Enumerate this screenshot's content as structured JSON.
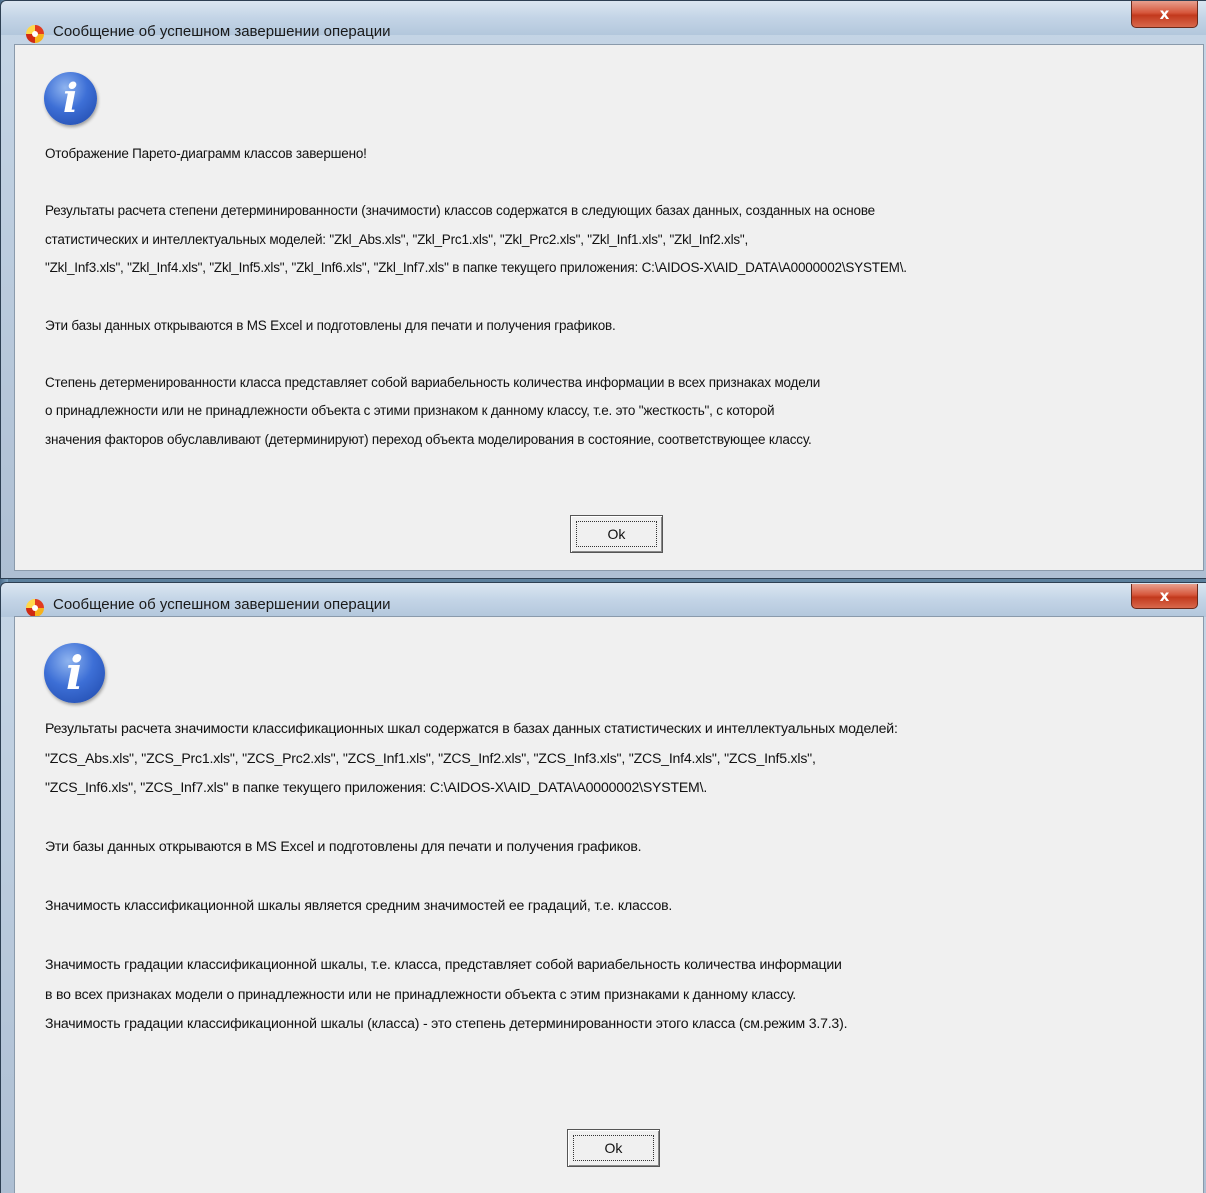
{
  "dialog1": {
    "title": "Сообщение об успешном завершении операции",
    "close_label": "x",
    "paragraphs": [
      [
        "Отображение Парето-диаграмм классов завершено!"
      ],
      [
        "Результаты расчета степени детерминированности (значимости) классов содержатся в следующих базах данных, созданных на основе",
        "статистических и интеллектуальных моделей: \"Zkl_Abs.xls\", \"Zkl_Prc1.xls\", \"Zkl_Prc2.xls\", \"Zkl_Inf1.xls\", \"Zkl_Inf2.xls\",",
        "\"Zkl_Inf3.xls\", \"Zkl_Inf4.xls\", \"Zkl_Inf5.xls\", \"Zkl_Inf6.xls\", \"Zkl_Inf7.xls\" в папке текущего приложения: C:\\AIDOS-X\\AID_DATA\\A0000002\\SYSTEM\\."
      ],
      [
        "Эти базы данных открываются в MS Excel и подготовлены для печати и получения графиков."
      ],
      [
        "Степень детерменированности класса представляет собой вариабельность количества информации в всех признаках модели",
        "о принадлежности или не принадлежности объекта с этими признаком к данному классу, т.е. это \"жесткость\", с которой",
        "значения факторов обуславливают (детерминируют) переход объекта моделирования в состояние, соответствующее классу."
      ]
    ],
    "ok_label": "Ok"
  },
  "dialog2": {
    "title": "Сообщение об успешном завершении операции",
    "close_label": "x",
    "paragraphs": [
      [
        "Результаты расчета значимости классификационных шкал содержатся в базах данных статистических и интеллектуальных моделей:",
        "\"ZCS_Abs.xls\", \"ZCS_Prc1.xls\", \"ZCS_Prc2.xls\", \"ZCS_Inf1.xls\", \"ZCS_Inf2.xls\", \"ZCS_Inf3.xls\", \"ZCS_Inf4.xls\", \"ZCS_Inf5.xls\",",
        "\"ZCS_Inf6.xls\", \"ZCS_Inf7.xls\" в папке текущего приложения: C:\\AIDOS-X\\AID_DATA\\A0000002\\SYSTEM\\."
      ],
      [
        "Эти базы данных открываются в MS Excel и подготовлены для печати и получения графиков."
      ],
      [
        "Значимость классификационной шкалы является средним значимостей ее градаций, т.е. классов."
      ],
      [
        "Значимость градации классификационной шкалы, т.е. класса, представляет собой вариабельность количества информации",
        "в во всех признаках модели о принадлежности или не принадлежности объекта с этим признаками к данному классу.",
        "Значимость градации классификационной шкалы (класса) - это степень детерминированности этого класса (см.режим 3.7.3)."
      ]
    ],
    "ok_label": "Ok"
  }
}
